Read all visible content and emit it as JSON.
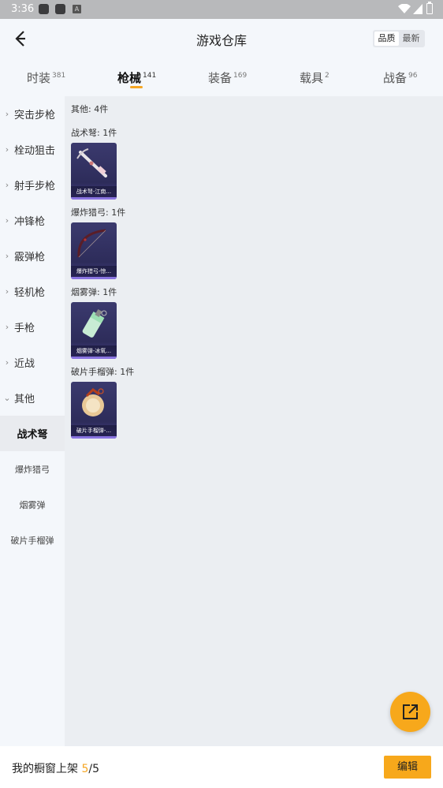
{
  "status_bar": {
    "time": "3:36",
    "notif_glyph": "A"
  },
  "header": {
    "title": "游戏仓库",
    "sort_options": [
      "品质",
      "最新"
    ]
  },
  "tabs": [
    {
      "label": "时装",
      "count": "381"
    },
    {
      "label": "枪械",
      "count": "141"
    },
    {
      "label": "装备",
      "count": "169"
    },
    {
      "label": "载具",
      "count": "2"
    },
    {
      "label": "战备",
      "count": "96"
    }
  ],
  "sidebar": {
    "categories": [
      "突击步枪",
      "栓动狙击",
      "射手步枪",
      "冲锋枪",
      "霰弹枪",
      "轻机枪",
      "手枪",
      "近战",
      "其他"
    ],
    "subitems": [
      "战术弩",
      "爆炸猎弓",
      "烟雾弹",
      "破片手榴弹"
    ]
  },
  "content": {
    "summary": "其他: 4件",
    "groups": [
      {
        "heading": "战术弩: 1件",
        "item_label": "战术弩-江南...",
        "icon": "crossbow-icon"
      },
      {
        "heading": "爆炸猎弓: 1件",
        "item_label": "爆炸猎弓-惊...",
        "icon": "bow-icon"
      },
      {
        "heading": "烟雾弹: 1件",
        "item_label": "烟雾弹-冰氧...",
        "icon": "smoke-grenade-icon"
      },
      {
        "heading": "破片手榴弹: 1件",
        "item_label": "破片手榴弹-...",
        "icon": "frag-grenade-icon"
      }
    ]
  },
  "bottom_bar": {
    "prefix": "我的橱窗上架 ",
    "current": "5",
    "slash": "/",
    "total": "5",
    "edit_label": "编辑"
  },
  "colors": {
    "accent": "#f7a81b",
    "card_bg": "#2d2c5a",
    "card_bar": "#8a74e0"
  }
}
